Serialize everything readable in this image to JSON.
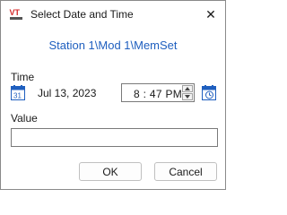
{
  "window": {
    "title": "Select Date and Time",
    "icon": "vtscada-logo",
    "close_glyph": "✕"
  },
  "heading": "Station 1\\Mod 1\\MemSet",
  "time_section": {
    "label": "Time",
    "date": "Jul 13, 2023",
    "time": "8 : 47  PM",
    "date_icon": "calendar-icon",
    "picker_icon": "calendar-clock-icon"
  },
  "value_section": {
    "label": "Value",
    "value": "",
    "placeholder": ""
  },
  "buttons": {
    "ok": "OK",
    "cancel": "Cancel"
  },
  "colors": {
    "heading": "#1f5fbf",
    "logo_red": "#d42a2a"
  }
}
